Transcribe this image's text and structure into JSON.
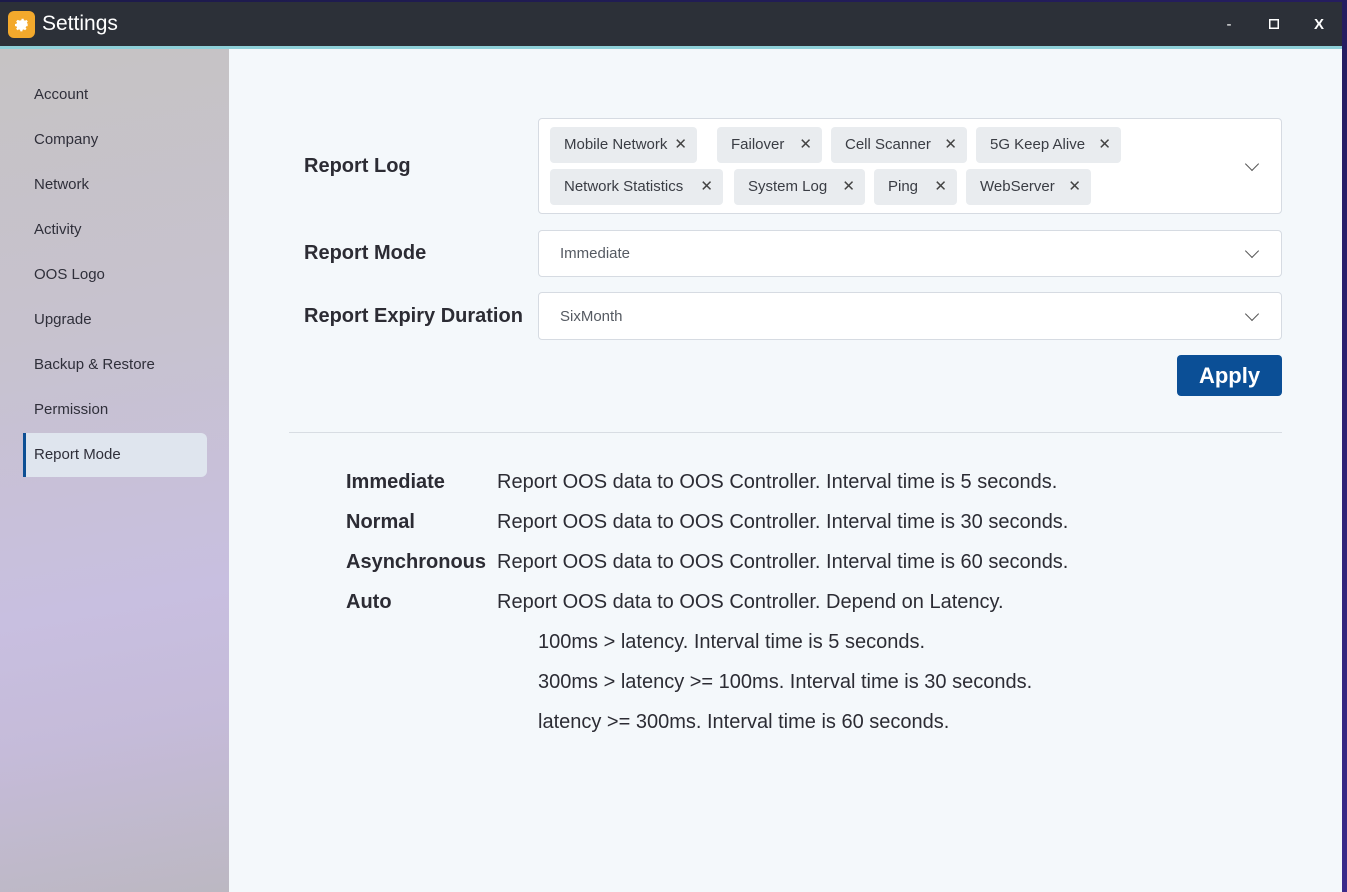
{
  "window": {
    "title": "Settings",
    "minimize_label": "-",
    "maximize_label": "□",
    "close_label": "X"
  },
  "sidebar": {
    "items": [
      {
        "label": "Account"
      },
      {
        "label": "Company"
      },
      {
        "label": "Network"
      },
      {
        "label": "Activity"
      },
      {
        "label": "OOS Logo"
      },
      {
        "label": "Upgrade"
      },
      {
        "label": "Backup & Restore"
      },
      {
        "label": "Permission"
      },
      {
        "label": "Report Mode",
        "active": true
      }
    ]
  },
  "form": {
    "report_log": {
      "label": "Report Log",
      "tags": [
        "Mobile Network",
        "Failover",
        "Cell Scanner",
        "5G Keep Alive",
        "Network Statistics",
        "System Log",
        "Ping",
        "WebServer"
      ]
    },
    "report_mode": {
      "label": "Report Mode",
      "value": "Immediate"
    },
    "report_expiry": {
      "label": "Report Expiry Duration",
      "value": "SixMonth"
    },
    "apply_label": "Apply"
  },
  "modes": [
    {
      "name": "Immediate",
      "desc": "Report OOS data to OOS Controller. Interval time is 5 seconds."
    },
    {
      "name": "Normal",
      "desc": "Report OOS data to OOS Controller. Interval time is 30 seconds."
    },
    {
      "name": "Asynchronous",
      "desc": "Report OOS data to OOS Controller. Interval time is 60 seconds."
    },
    {
      "name": "Auto",
      "desc": "Report OOS data to OOS Controller. Depend on Latency."
    }
  ],
  "auto_details": [
    "100ms > latency. Interval time is 5 seconds.",
    "300ms > latency >= 100ms. Interval time is 30 seconds.",
    "latency >= 300ms. Interval time is 60 seconds."
  ],
  "colors": {
    "accent": "#0b4f96",
    "titlebar": "#2c3038",
    "app_icon": "#f3a92c"
  },
  "icons": {
    "app": "gear-icon",
    "chip_remove": "close-icon",
    "dropdown": "chevron-down-icon"
  }
}
